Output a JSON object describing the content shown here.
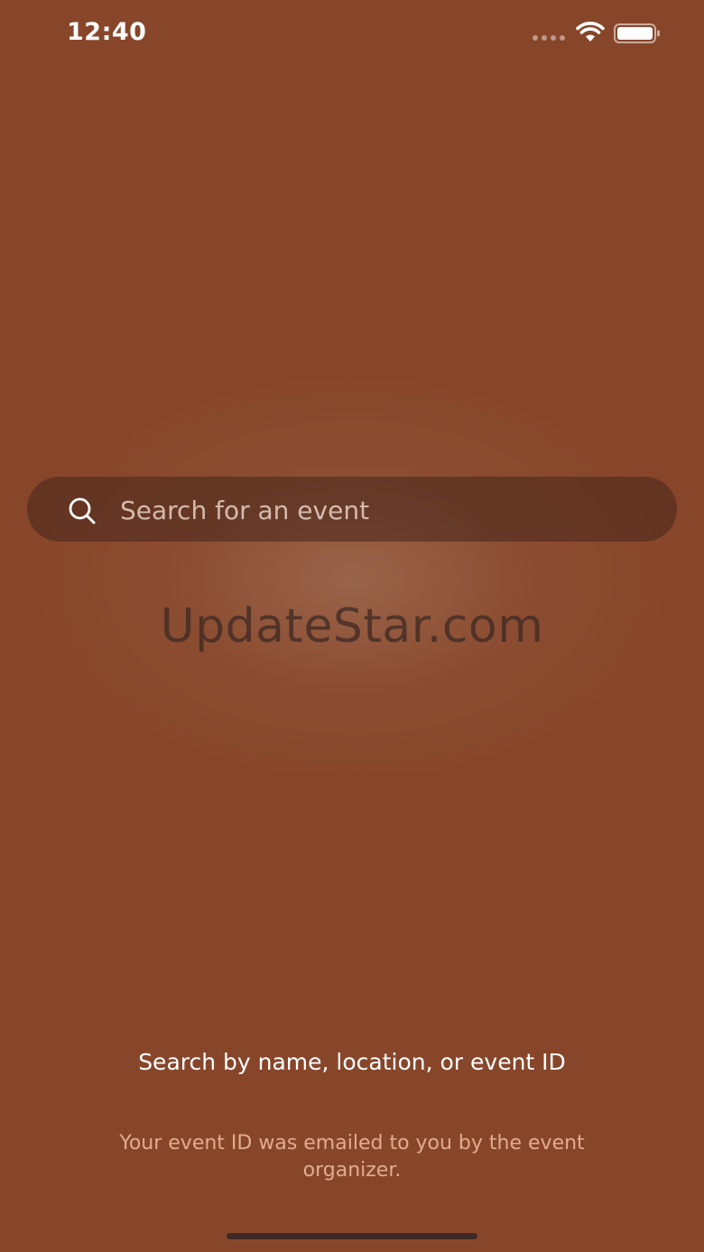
{
  "status_bar": {
    "time": "12:40",
    "icons": [
      "signal-dots-icon",
      "wifi-icon",
      "battery-icon"
    ]
  },
  "search": {
    "placeholder": "Search for an event",
    "value": "",
    "icon": "search-icon"
  },
  "watermark": "UpdateStar.com",
  "hint": {
    "title": "Search by name, location, or event ID",
    "subtitle": "Your event ID was emailed to you by the event organizer."
  },
  "colors": {
    "background": "#87462a",
    "search_bar": "#5b3426",
    "hint_subtitle": "#e9b89f"
  }
}
